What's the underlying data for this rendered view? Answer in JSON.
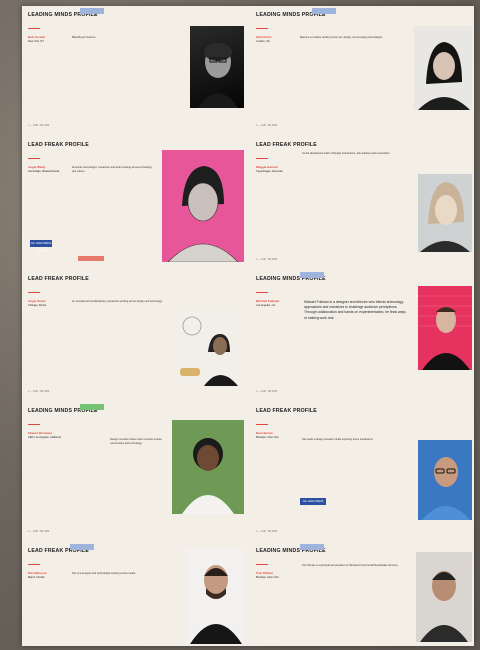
{
  "colors": {
    "accent_red": "#e0463f",
    "tag_blue": "#9fb4dd",
    "tag_green": "#74c274",
    "button_blue": "#2d4fa3",
    "pink": "#e8569a"
  },
  "cards": [
    {
      "title": "LEADING MINDS PROFILE",
      "name": "Bob Joseph",
      "location": "New York, NY",
      "body": "Baba Bayou Susumu.",
      "footer": "1 — LMP • SE 1950"
    },
    {
      "title": "LEADING MINDS PROFILE",
      "name": "Shin Kwon",
      "location": "London, UK",
      "body": "Maroa is a creative working across art, design, and emerging technologies.",
      "footer": "1 — LMP • SE 1950"
    },
    {
      "title": "LEAD FREAK PROFILE",
      "name": "Angie Wang",
      "location": "Cambridge, Massachusetts",
      "body": "American technologist, researcher and writer working across technology and culture.",
      "button": "Join LEAD FREAK Network",
      "footer": "1 — LMP • SE 1950"
    },
    {
      "title": "LEAD FREAK PROFILE",
      "name": "Maggie Hanson",
      "location": "Copenhagen, Denmark",
      "body": "As the department chair of Design Interactions, she teaches and researches.",
      "footer": "1 — LMP • SE 1950"
    },
    {
      "title": "LEAD FREAK PROFILE",
      "name": "Angie Smart",
      "location": "Chicago, Illinois",
      "body": "An exceptional interdisciplinary researcher working across design and technology.",
      "footer": "1 — LMP • SE 1950"
    },
    {
      "title": "LEADING MINDS PROFILE",
      "name": "Michael Fullman",
      "location": "Los Angeles, CA",
      "quote": "Michael Fullman is a designer and director who blends technology, approaches and narratives to challenge audience perceptions. Through collaboration and hands on experimentation, he finds ways of making work real.",
      "footer": "1 — LMP • SE 1950"
    },
    {
      "title": "LEADING MINDS PROFILE",
      "name": "Sharon Brisbane",
      "location": "CEP, Los Angeles, California",
      "body": "Design innovator whose work connects culture, communities and technology.",
      "footer": "1 — LMP • SE 1950"
    },
    {
      "title": "LEAD FREAK PROFILE",
      "name": "Dan Hernan",
      "location": "Brooklyn, New York",
      "body": "Dan leads a design research studio exploring future interactions.",
      "button": "Join LEAD FREAK Network",
      "footer": "1 — LMP • SE 1950"
    },
    {
      "title": "LEAD FREAK PROFILE",
      "name": "Pan Mansoor",
      "location": "Miami, Florida",
      "body": "Pan is a designer and technologist working across media.",
      "footer": "1 — LMP • SE 1950"
    },
    {
      "title": "LEADING MINDS PROFILE",
      "name": "Tom Pilman",
      "location": "Brooklyn, New York",
      "body": "Tom Pilman is a principal and president at Hartwood Commercial Real Estate Services.",
      "footer": "1 — LMP • SE 1950"
    }
  ]
}
